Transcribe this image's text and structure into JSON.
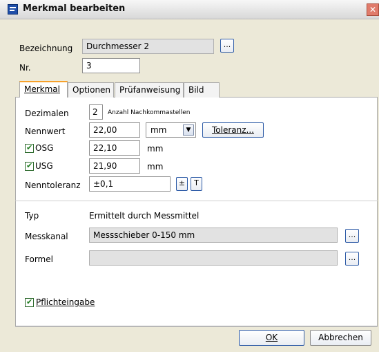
{
  "window": {
    "title": "Merkmal bearbeiten"
  },
  "fields": {
    "bezeichnung_label": "Bezeichnung",
    "bezeichnung_value": "Durchmesser 2",
    "nr_label": "Nr.",
    "nr_value": "3"
  },
  "tabs": [
    {
      "label": "Merkmal"
    },
    {
      "label": "Optionen"
    },
    {
      "label": "Prüfanweisung"
    },
    {
      "label": "Bild"
    }
  ],
  "merkmal": {
    "dezimalen_label": "Dezimalen",
    "dezimalen_value": "2",
    "dezimalen_hint": "Anzahl Nachkommastellen",
    "nennwert_label": "Nennwert",
    "nennwert_value": "22,00",
    "unit_selected": "mm",
    "toleranz_button": "Toleranz...",
    "osg_label": "OSG",
    "osg_value": "22,10",
    "osg_unit": "mm",
    "usg_label": "USG",
    "usg_value": "21,90",
    "usg_unit": "mm",
    "nenntoleranz_label": "Nenntoleranz",
    "nenntoleranz_value": "±0,1",
    "pm_button": "±",
    "t_button": "T",
    "typ_label": "Typ",
    "typ_value": "Ermittelt durch Messmittel",
    "messkanal_label": "Messkanal",
    "messkanal_value": "Messschieber 0-150 mm",
    "formel_label": "Formel",
    "formel_value": "",
    "pflicht_label": "Pflichteingabe"
  },
  "buttons": {
    "ellipsis": "...",
    "ok": "OK",
    "cancel": "Abbrechen"
  },
  "icons": {
    "title": "window-app-icon",
    "close": "close-icon",
    "dropdown": "chevron-down-icon",
    "check": "checkmark-icon"
  },
  "colors": {
    "accent_tab": "#f7a12b",
    "button_border": "#2c5aa6",
    "checkbox_check": "#1c7a1c",
    "title_icon": "#1f4ea8"
  }
}
